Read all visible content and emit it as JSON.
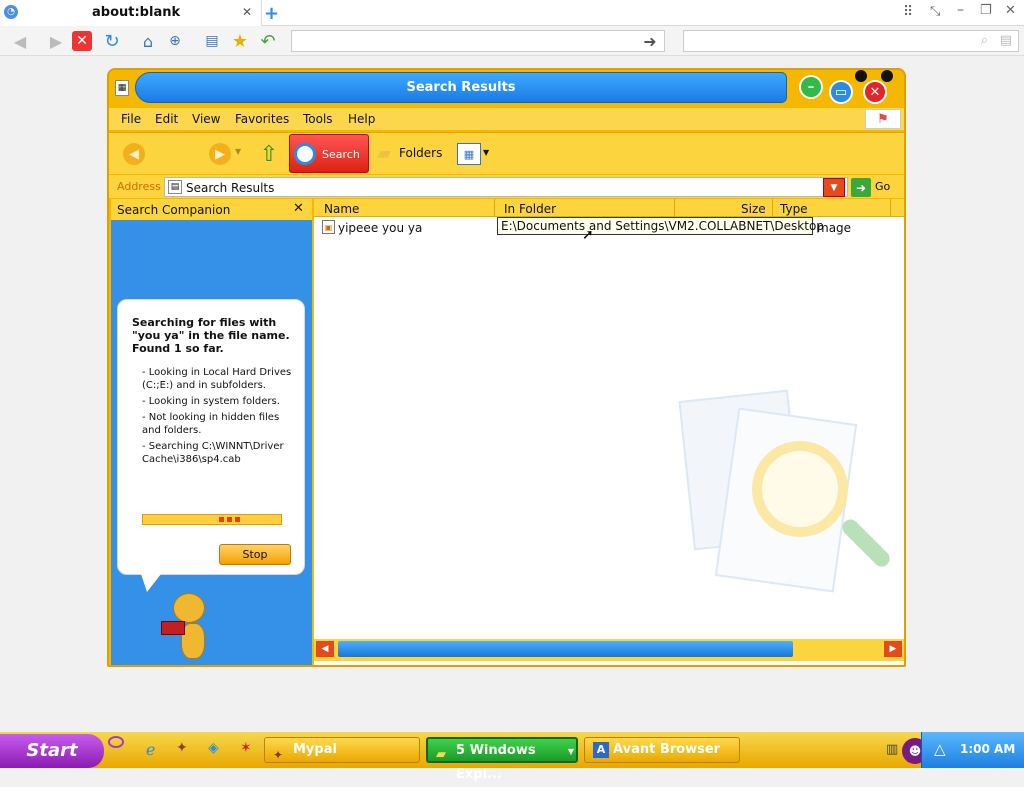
{
  "browser": {
    "tab_title": "about:blank",
    "address_value": "",
    "search_value": ""
  },
  "window": {
    "title": "Search Results",
    "menu": [
      "File",
      "Edit",
      "View",
      "Favorites",
      "Tools",
      "Help"
    ],
    "toolbar": {
      "back_label": "",
      "search_label": "Search",
      "folders_label": "Folders"
    },
    "address": {
      "label": "Address",
      "value": "Search Results",
      "go_label": "Go"
    }
  },
  "companion": {
    "header": "Search Companion",
    "status_bold": "Searching for files with \"you ya\" in the file name.  Found 1 so far.",
    "lines": [
      "- Looking in Local Hard Drives (C:;E:) and in subfolders.",
      "- Looking in system folders.",
      "- Not looking in hidden files and folders.",
      "- Searching C:\\WINNT\\Driver Cache\\i386\\sp4.cab"
    ],
    "stop_label": "Stop"
  },
  "results": {
    "columns": [
      "Name",
      "In Folder",
      "Size",
      "Type"
    ],
    "rows": [
      {
        "name": "yipeee you ya",
        "type": "mage"
      }
    ],
    "tooltip": "E:\\Documents and Settings\\VM2.COLLABNET\\Desktop"
  },
  "taskbar": {
    "start_label": "Start",
    "tasks": [
      "Mypal",
      "5 Windows Expl...",
      "Avant Browser"
    ],
    "clock": "1:00 AM"
  },
  "colors": {
    "accent": "#f5b800",
    "title_blue": "#1b7be6",
    "companion_blue": "#3591e8"
  }
}
